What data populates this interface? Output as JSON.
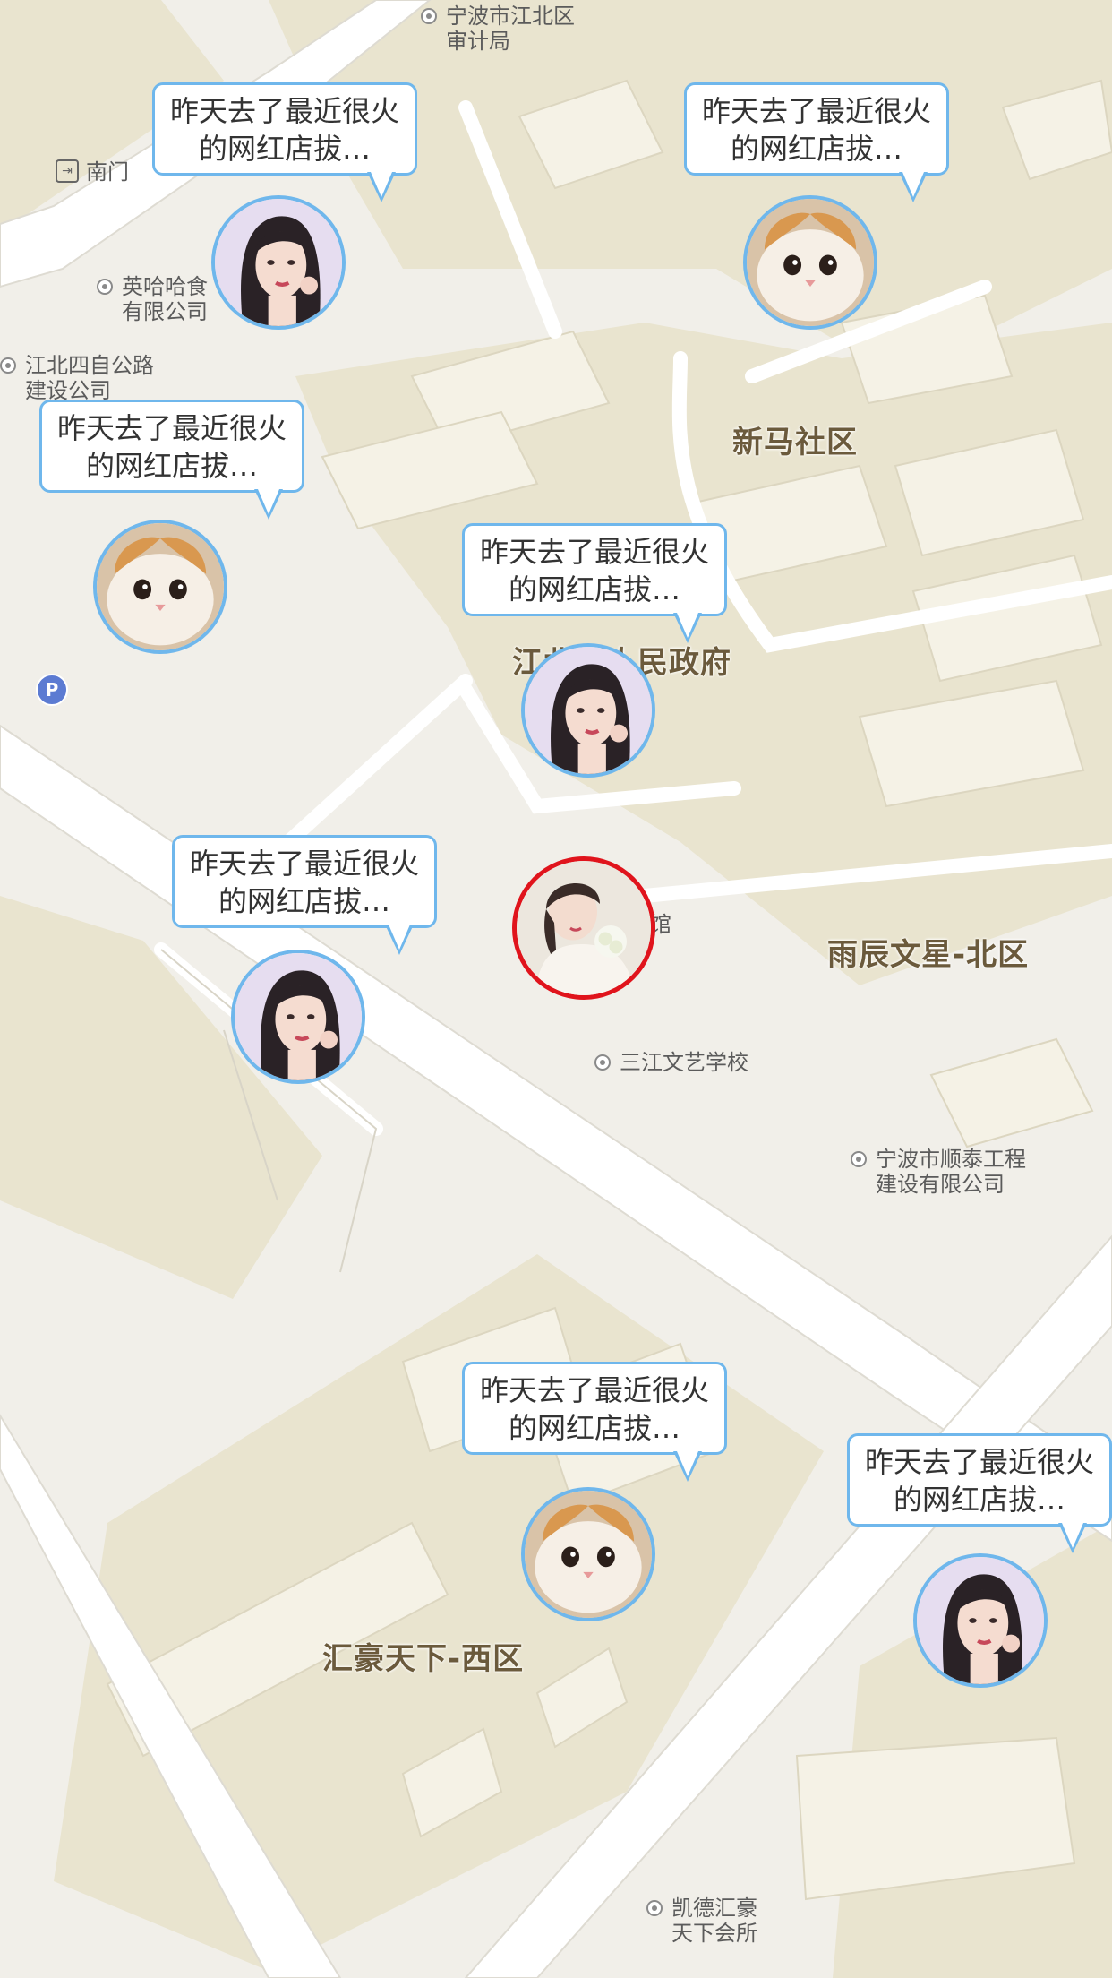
{
  "map": {
    "poi_labels": [
      {
        "id": "audit",
        "text": "宁波市江北区\n审计局"
      },
      {
        "id": "south-gate",
        "text": "南门"
      },
      {
        "id": "company1",
        "text": "英哈哈食\n有限公司"
      },
      {
        "id": "road-company",
        "text": "江北四自公路\n建设公司"
      },
      {
        "id": "art-school",
        "text": "三江文艺学校"
      },
      {
        "id": "shuntai",
        "text": "宁波市顺泰工程\n建设有限公司"
      },
      {
        "id": "kaide",
        "text": "凯德汇豪\n天下会所"
      }
    ],
    "area_labels": [
      {
        "id": "xinma",
        "text": "新马社区"
      },
      {
        "id": "gov",
        "text": "江北区人民政府"
      },
      {
        "id": "yuchen",
        "text": "雨辰文星-北区"
      },
      {
        "id": "huihao",
        "text": "汇豪天下-西区"
      }
    ],
    "partial_label": "馆"
  },
  "markers": [
    {
      "id": "m1",
      "bubble_text": "昨天去了最近很火的网红店拔…",
      "avatar": "girl"
    },
    {
      "id": "m2",
      "bubble_text": "昨天去了最近很火的网红店拔…",
      "avatar": "cat"
    },
    {
      "id": "m3",
      "bubble_text": "昨天去了最近很火的网红店拔…",
      "avatar": "cat"
    },
    {
      "id": "m4",
      "bubble_text": "昨天去了最近很火的网红店拔…",
      "avatar": "girl"
    },
    {
      "id": "m5",
      "bubble_text": "昨天去了最近很火的网红店拔…",
      "avatar": "girl"
    },
    {
      "id": "m6",
      "bubble_text": "昨天去了最近很火的网红店拔…",
      "avatar": "cat"
    },
    {
      "id": "m7",
      "bubble_text": "昨天去了最近很火的网红店拔…",
      "avatar": "girl"
    }
  ],
  "current_user": {
    "avatar": "bride"
  },
  "colors": {
    "bubble_border": "#6fb7ec",
    "current_user_ring": "#e0141c",
    "block": "#e9e4d0",
    "road": "#ffffff",
    "parking": "#5c7bd2"
  }
}
